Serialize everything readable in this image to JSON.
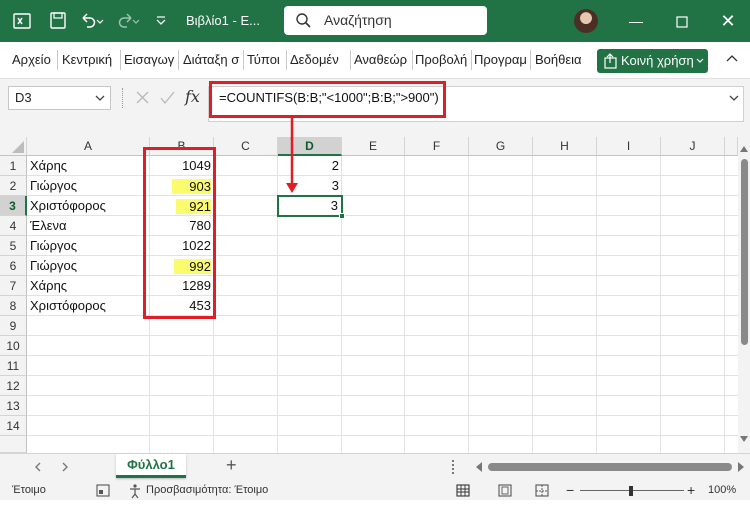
{
  "colors": {
    "excel_green": "#217346",
    "annotation_red": "#e01e25",
    "highlight": "#fbfb6e",
    "selection": "#217346"
  },
  "titlebar": {
    "app_icon": "excel-icon",
    "save_icon": "save-icon",
    "undo_icon": "undo-icon",
    "redo_icon": "redo-icon",
    "doc_title": "Βιβλίο1 - E...",
    "search_placeholder": "Αναζήτηση",
    "minimize_icon": "minimize-icon",
    "restore_icon": "restore-icon",
    "close_icon": "close-icon"
  },
  "ribbon": {
    "tabs": [
      "Αρχείο",
      "Κεντρική",
      "Εισαγωγ",
      "Διάταξη σ",
      "Τύποι",
      "Δεδομέν",
      "Αναθεώρ",
      "Προβολή",
      "Προγραμ",
      "Βοήθεια"
    ],
    "share_label": "Κοινή χρήση"
  },
  "formula_bar": {
    "name_box": "D3",
    "fx_label": "fx",
    "formula": "=COUNTIFS(B:B;\"<1000\";B:B;\">900\")"
  },
  "sheet": {
    "columns": [
      "A",
      "B",
      "C",
      "D",
      "E",
      "F",
      "G",
      "H",
      "I",
      "J"
    ],
    "rows": [
      "1",
      "2",
      "3",
      "4",
      "5",
      "6",
      "7",
      "8",
      "9",
      "10",
      "11",
      "12",
      "13",
      "14"
    ],
    "col_a": [
      "Χάρης",
      "Γιώργος",
      "Χριστόφορος",
      "Έλενα",
      "Γιώργος",
      "Γιώργος",
      "Χάρης",
      "Χριστόφορος"
    ],
    "col_b": [
      "1049",
      "903",
      "921",
      "780",
      "1022",
      "992",
      "1289",
      "453"
    ],
    "highlighted_b": [
      false,
      true,
      true,
      false,
      false,
      true,
      false,
      false
    ],
    "col_d": [
      "2",
      "3",
      "3"
    ]
  },
  "sheet_tabs": {
    "active": "Φύλλο1",
    "add": "+"
  },
  "status": {
    "ready": "Έτοιμο",
    "accessibility": "Προσβασιμότητα: Έτοιμο",
    "zoom": "100%"
  }
}
